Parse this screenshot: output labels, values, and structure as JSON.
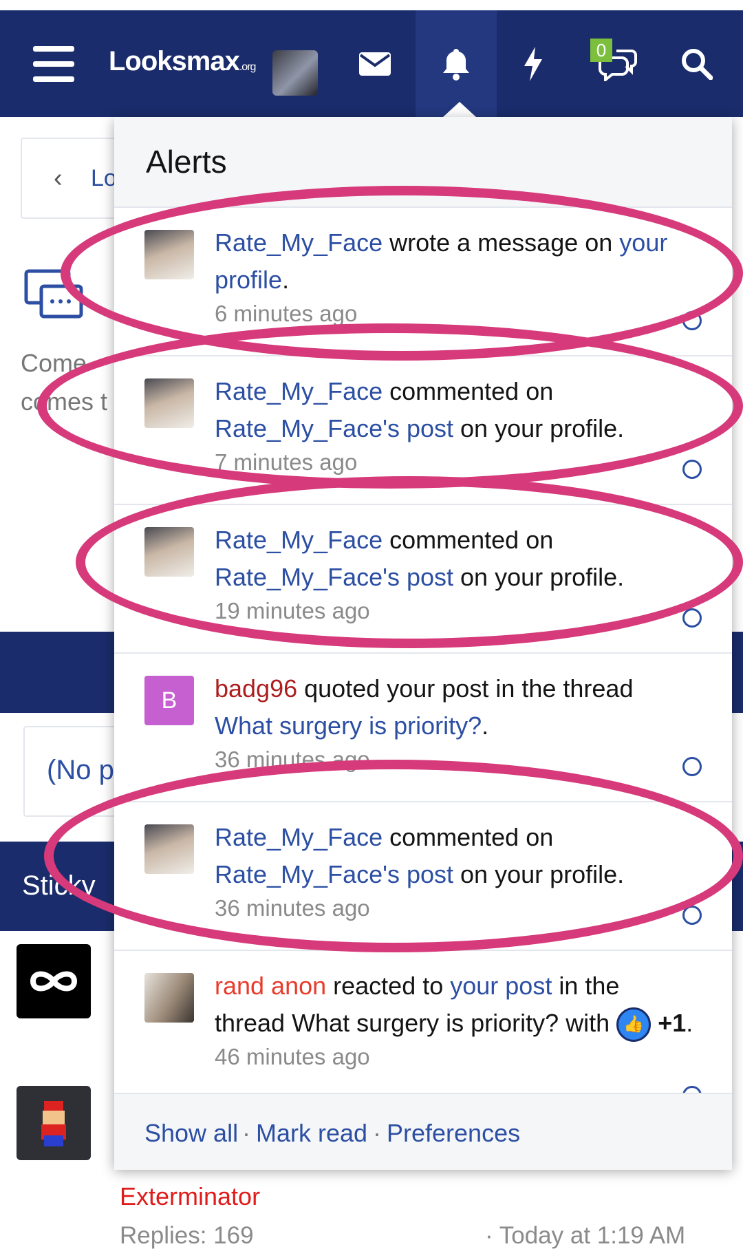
{
  "header": {
    "logo_main": "Looksmax",
    "logo_suffix": ".org",
    "conversations_badge": "0"
  },
  "background": {
    "breadcrumb": "Lo",
    "forum_desc_line1": "Come",
    "forum_desc_line2": "comes t",
    "prefix_filter": "(No p",
    "sticky_label": "Sticky",
    "thread_author": "Exterminator",
    "replies": "Replies: 169",
    "last_post": "· Today at 1:19 AM"
  },
  "alerts": {
    "title": "Alerts",
    "items": [
      {
        "user": "Rate_My_Face",
        "text1": " wrote a message on ",
        "link1": "your profile",
        "text2": ".",
        "link2": "",
        "text3": "",
        "time": "6 minutes ago"
      },
      {
        "user": "Rate_My_Face",
        "text1": " commented on ",
        "link1": "Rate_My_Face's post",
        "text2": " on your profile.",
        "link2": "",
        "text3": "",
        "time": "7 minutes ago"
      },
      {
        "user": "Rate_My_Face",
        "text1": " commented on ",
        "link1": "Rate_My_Face's post",
        "text2": " on your profile.",
        "link2": "",
        "text3": "",
        "time": "19 minutes ago"
      },
      {
        "user": "badg96",
        "avatar_letter": "B",
        "text1": " quoted your post in the thread ",
        "link1": "What surgery is priority?",
        "text2": ".",
        "time": "36 minutes ago"
      },
      {
        "user": "Rate_My_Face",
        "text1": " commented on ",
        "link1": "Rate_My_Face's post",
        "text2": " on your profile.",
        "time": "36 minutes ago"
      },
      {
        "user": "rand anon",
        "text1": " reacted to ",
        "link1": "your post",
        "text2": " in the thread What surgery is priority? with ",
        "reaction": "+1",
        "text3": ".",
        "time": "46 minutes ago"
      }
    ],
    "footer": {
      "show_all": "Show all",
      "mark_read": "Mark read",
      "preferences": "Preferences"
    }
  },
  "colors": {
    "brand": "#1a2c6b",
    "link": "#2c4fa3",
    "annotation": "#d63a7a"
  }
}
